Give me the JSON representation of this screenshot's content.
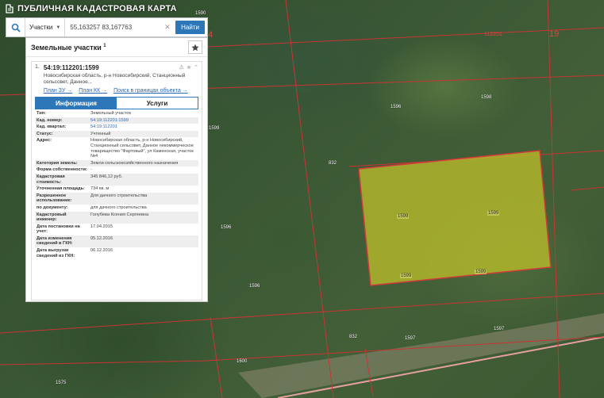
{
  "header": {
    "title": "ПУБЛИЧНАЯ КАДАСТРОВАЯ КАРТА"
  },
  "search": {
    "type": "Участки",
    "query": "55,163257 83,167763",
    "button": "Найти"
  },
  "panel": {
    "title": "Земельные участки",
    "count": "1",
    "entry": {
      "num": "1.",
      "id": "54:19:112201:1599",
      "address": "Новосибирская область, р-н Новосибирский, Станционный сельсовет, Данное...",
      "links": [
        "План ЗУ →",
        "План КК →",
        "Поиск в границах объекта →"
      ]
    },
    "tabs": [
      "Информация",
      "Услуги"
    ],
    "attributes": [
      {
        "key": "Тип:",
        "value": "Земельный участок"
      },
      {
        "key": "Кад. номер:",
        "value": "54:19:112201:1599"
      },
      {
        "key": "Кад. квартал:",
        "value": "54:19:112201"
      },
      {
        "key": "Статус:",
        "value": "Учтенный"
      },
      {
        "key": "Адрес:",
        "value": "Новосибирская область, р-н Новосибирский, Станционный сельсовет, Данное некоммерческое товарищество \"Фартовый\", ул Каменская, участок №4"
      },
      {
        "key": "Категория земель:",
        "value": "Земли сельскохозяйственного назначения"
      },
      {
        "key": "Форма собственности:",
        "value": "-"
      },
      {
        "key": "Кадастровая стоимость:",
        "value": "345 846,12 руб."
      },
      {
        "key": "Уточненная площадь:",
        "value": "734 кв. м"
      },
      {
        "key": "Разрешенное использование:",
        "value": "Для дачного строительства"
      },
      {
        "key": "по документу:",
        "value": "для дачного строительства"
      },
      {
        "key": "Кадастровый инженер:",
        "value": "Голубева Ксения Сергеевна"
      },
      {
        "key": "Дата постановки на учет:",
        "value": "17.04.2015"
      },
      {
        "key": "Дата изменения сведений в ГКН:",
        "value": "05.12.2016"
      },
      {
        "key": "Дата выгрузки сведений из ГКН:",
        "value": "06.12.2016"
      }
    ]
  },
  "map": {
    "labels": {
      "l1590": "1590",
      "l4": "4",
      "l112201": "112201",
      "l19": "19",
      "l1596a": "1596",
      "l1598": "1598",
      "l832a": "832",
      "l1599a": "1599",
      "l1599b": "1599",
      "l1599c": "1599",
      "l1599d": "1599",
      "l1599e": "1599",
      "l1596b": "1596",
      "l1596c": "1596",
      "l832b": "832",
      "l1597a": "1597",
      "l1597b": "1597",
      "l1600": "1600",
      "l1575": "1575"
    },
    "colors": {
      "parcel_fill": "#c4c42a",
      "boundary": "#d23a3a",
      "road": "#e08a8a"
    }
  }
}
